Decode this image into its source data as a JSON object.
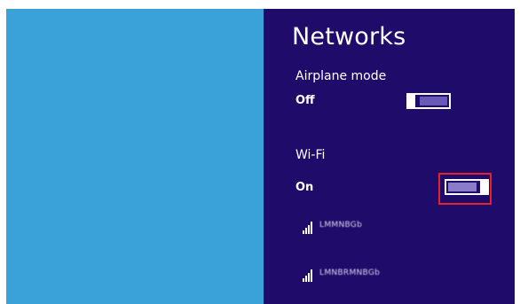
{
  "charm": {
    "title": "Networks",
    "airplane_mode": {
      "label": "Airplane mode",
      "state": "Off",
      "on": false
    },
    "wifi": {
      "label": "Wi-Fi",
      "state": "On",
      "on": true
    },
    "networks": [
      {
        "name": "LMMNBGb",
        "icon": "wifi-signal-icon"
      },
      {
        "name": "LMNBRMNBGb",
        "icon": "wifi-signal-icon"
      }
    ]
  },
  "colors": {
    "desktop": "#3aa1d9",
    "charm_background": "#1f0c6a",
    "highlight": "#e8202a"
  }
}
